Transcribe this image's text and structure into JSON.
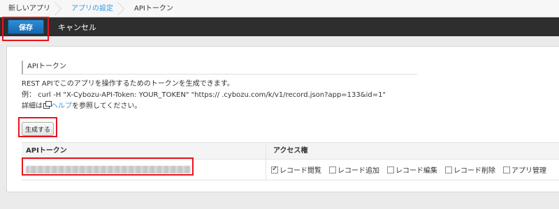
{
  "breadcrumb": {
    "items": [
      {
        "label": "新しいアプリ",
        "link": false
      },
      {
        "label": "アプリの設定",
        "link": true
      },
      {
        "label": "APIトークン",
        "link": false
      }
    ]
  },
  "toolbar": {
    "save_label": "保存",
    "cancel_label": "キャンセル"
  },
  "section": {
    "title": "APIトークン",
    "description_line1": "REST APIでこのアプリを操作するためのトークンを生成できます。",
    "example_line": "例： curl -H \"X-Cybozu-API-Token: YOUR_TOKEN\"  \"https://     .cybozu.com/k/v1/record.json?app=133&id=1\"",
    "detail_prefix": "詳細は",
    "help_link": "ヘルプ",
    "detail_suffix": "を参照してください。"
  },
  "generate_button": "生成する",
  "table": {
    "headers": [
      "APIトークン",
      "アクセス権"
    ],
    "permissions": [
      {
        "label": "レコード閲覧",
        "checked": true
      },
      {
        "label": "レコード追加",
        "checked": false
      },
      {
        "label": "レコード編集",
        "checked": false
      },
      {
        "label": "レコード削除",
        "checked": false
      },
      {
        "label": "アプリ管理",
        "checked": false
      }
    ]
  },
  "colors": {
    "accent": "#1e7ac7",
    "highlight": "#e8141e",
    "link": "#3498db"
  }
}
